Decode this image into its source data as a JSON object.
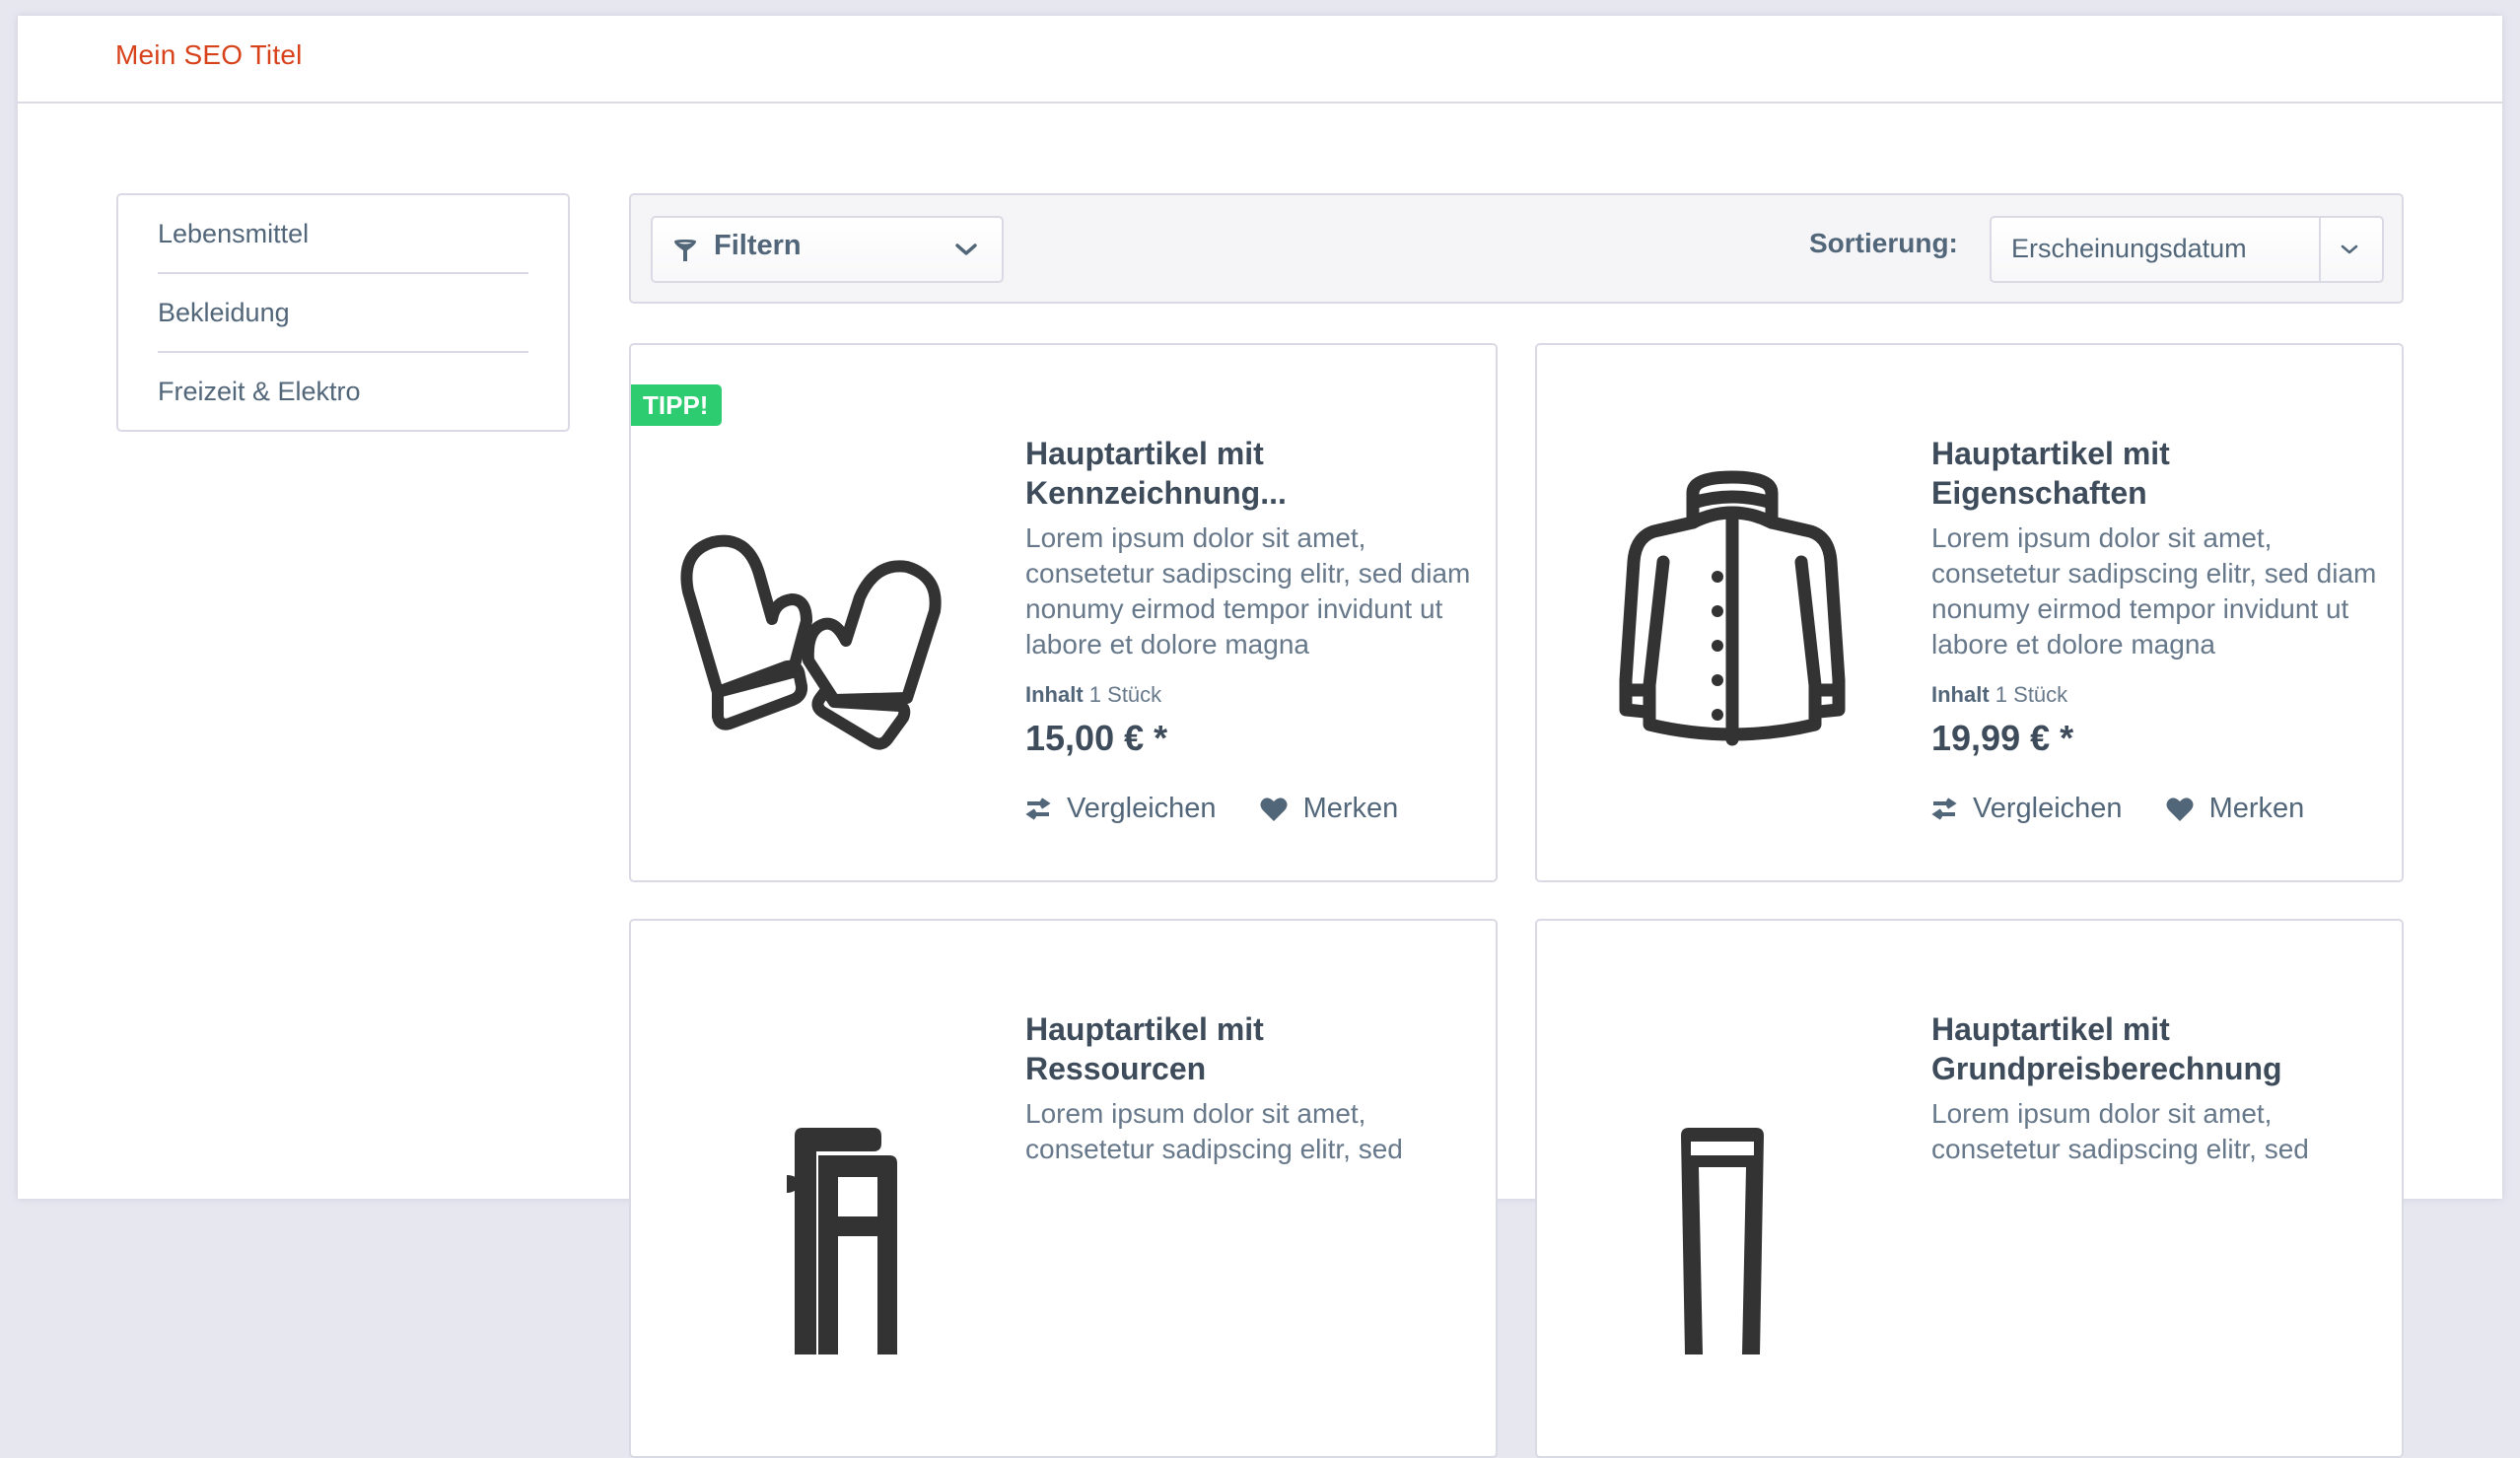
{
  "header": {
    "title": "Mein SEO Titel"
  },
  "sidebar": {
    "items": [
      {
        "label": "Lebensmittel"
      },
      {
        "label": "Bekleidung"
      },
      {
        "label": "Freizeit & Elektro"
      }
    ]
  },
  "toolbar": {
    "filter_label": "Filtern",
    "filter_icon": "filter-funnel-icon",
    "sort_label": "Sortierung:",
    "sort_value": "Erscheinungsdatum"
  },
  "products": [
    {
      "badge": "TIPP!",
      "image_icon": "mittens-icon",
      "title_line1": "Hauptartikel mit",
      "title_line2": "Kennzeichnung...",
      "description": "Lorem ipsum dolor sit amet, consetetur sadipscing elitr, sed diam nonumy eirmod tempor invidunt ut labore et dolore magna",
      "content_label": "Inhalt",
      "content_value": "1 Stück",
      "price": "15,00 € *",
      "compare_label": "Vergleichen",
      "wishlist_label": "Merken"
    },
    {
      "badge": null,
      "image_icon": "jacket-icon",
      "title_line1": "Hauptartikel mit",
      "title_line2": "Eigenschaften",
      "description": "Lorem ipsum dolor sit amet, consetetur sadipscing elitr, sed diam nonumy eirmod tempor invidunt ut labore et dolore magna",
      "content_label": "Inhalt",
      "content_value": "1 Stück",
      "price": "19,99 € *",
      "compare_label": "Vergleichen",
      "wishlist_label": "Merken"
    },
    {
      "badge": null,
      "image_icon": "chairs-icon",
      "title_line1": "Hauptartikel mit",
      "title_line2": "Ressourcen",
      "description": "Lorem ipsum dolor sit amet, consetetur sadipscing elitr, sed"
    },
    {
      "badge": null,
      "image_icon": "glass-icon",
      "title_line1": "Hauptartikel mit",
      "title_line2": "Grundpreisberechnung",
      "description": "Lorem ipsum dolor sit amet, consetetur sadipscing elitr, sed"
    }
  ],
  "colors": {
    "brand_title": "#d8421a",
    "badge": "#2ecc71",
    "text": "#52667a",
    "heading": "#3d4b5a"
  }
}
